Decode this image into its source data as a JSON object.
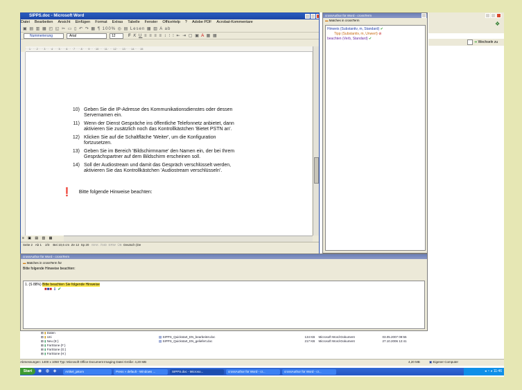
{
  "word": {
    "title": "SIPPS.doc - Microsoft Word",
    "menu": [
      "Datei",
      "Bearbeiten",
      "Ansicht",
      "Einfügen",
      "Format",
      "Extras",
      "Tabelle",
      "Fenster",
      "OfficeHelp",
      "?",
      "Adobe PDF",
      "Acrobat-Kommentare"
    ],
    "style_value": "Nummerierung",
    "font_value": "Arial",
    "size_value": "12",
    "zoom_value": "100%",
    "lesen_label": "Lesen",
    "weiter_label": "Wechseln zu",
    "doc_items": [
      {
        "num": "10)",
        "lines": [
          "Geben Sie die IP-Adresse des Kommunikationsdienstes oder dessen",
          "Servernamen ein."
        ]
      },
      {
        "num": "11)",
        "lines": [
          "Wenn der Dienst Gespräche ins öffentliche Telefonnetz anbietet, dann",
          "aktivieren Sie zusätzlich noch das Kontrollkästchen 'Bietet PSTN an'."
        ]
      },
      {
        "num": "12)",
        "lines": [
          "Klicken Sie auf die Schaltfläche 'Weiter', um die Konfiguration",
          "fortzusetzen."
        ]
      },
      {
        "num": "13)",
        "lines": [
          "Geben Sie im Bereich 'Bildschirmname' den Namen ein, der bei Ihrem",
          "Gesprächspartner auf dem Bildschirm erscheinen soll."
        ]
      },
      {
        "num": "14)",
        "lines": [
          "Soll der Audiostream und damit das Gespräch verschlüsselt werden,",
          "aktivieren Sie das Kontrollkästchen 'Audiostream verschlüsseln'."
        ]
      }
    ],
    "note_text": "Bitte folgende Hinweise beachten:",
    "status": {
      "seite": "Seite 2",
      "ab": "Ab 1",
      "pages": "2/3",
      "bei": "Bei 10,6 cm",
      "ze": "Ze 12",
      "sp": "Sp 20",
      "mak": "MAK",
      "and": "ÄND",
      "erw": "ERW",
      "ub": "ÜB",
      "lang": "Deutsch (De"
    }
  },
  "cross_right": {
    "title": "crossAuthor für Word - crossTerm",
    "matches": "Matches in crossTerm",
    "entries": [
      {
        "text": "Hinweis (Substantiv, m, Standard)",
        "mark": "✔",
        "mark_kind": "check",
        "color": "#1b3aa8"
      },
      {
        "text": "Tipp (Substantiv, m, Unwert)",
        "mark": "⊘",
        "mark_kind": "nope",
        "color": "#c76a10"
      },
      {
        "text": "beachten (Verb, Standard)",
        "mark": "✔",
        "mark_kind": "check",
        "color": "#6a2aa0"
      }
    ]
  },
  "cross_bottom": {
    "title": "crossAuthor für Word - crossTerm",
    "matches": "Matches in crossTerm für",
    "query": "Bitte folgende Hinweise beachten:",
    "result_prefix": "1. (S 88%)",
    "result_hl": "Bitte beachten Sie folgende Hinweise"
  },
  "explorer": {
    "tree": [
      "Daten",
      "Uni",
      "Neu (E:)",
      "FarStone (F:)",
      "FarStone (G:)",
      "FarStone (H:)",
      "FarStone (I:)"
    ],
    "files": [
      {
        "name": "SIPPS_Quickstart_EN_bearbeitet.doc",
        "size": "134 KB",
        "type": "Microsoft Word-Dokument",
        "date": "03.05.2007 09:55"
      },
      {
        "name": "SIPPS_Quickstart_EN_geliefert.doc",
        "size": "217 KB",
        "type": "Microsoft Word-Dokument",
        "date": "27.10.2006 12:41"
      }
    ],
    "status_left": "Abmessungen: 1400 x 1050 Typ: Microsoft Office Document Imaging Datei Größe: 4,20 MB",
    "status_size": "4,20 MB",
    "status_right": "Eigener Computer"
  },
  "taskbar": {
    "start": "Start",
    "buttons": [
      "Artikel_jakom",
      "Press » default - Windows ...",
      "SIPPS.doc - Microso...",
      "crossAuthor für Word - cr...",
      "crossAuthor für Word - cr..."
    ],
    "clock": "11:46"
  },
  "colors": {
    "highlight": "#fde84a",
    "flag_red": "#c0141a",
    "check_green": "#2a9d2a"
  }
}
